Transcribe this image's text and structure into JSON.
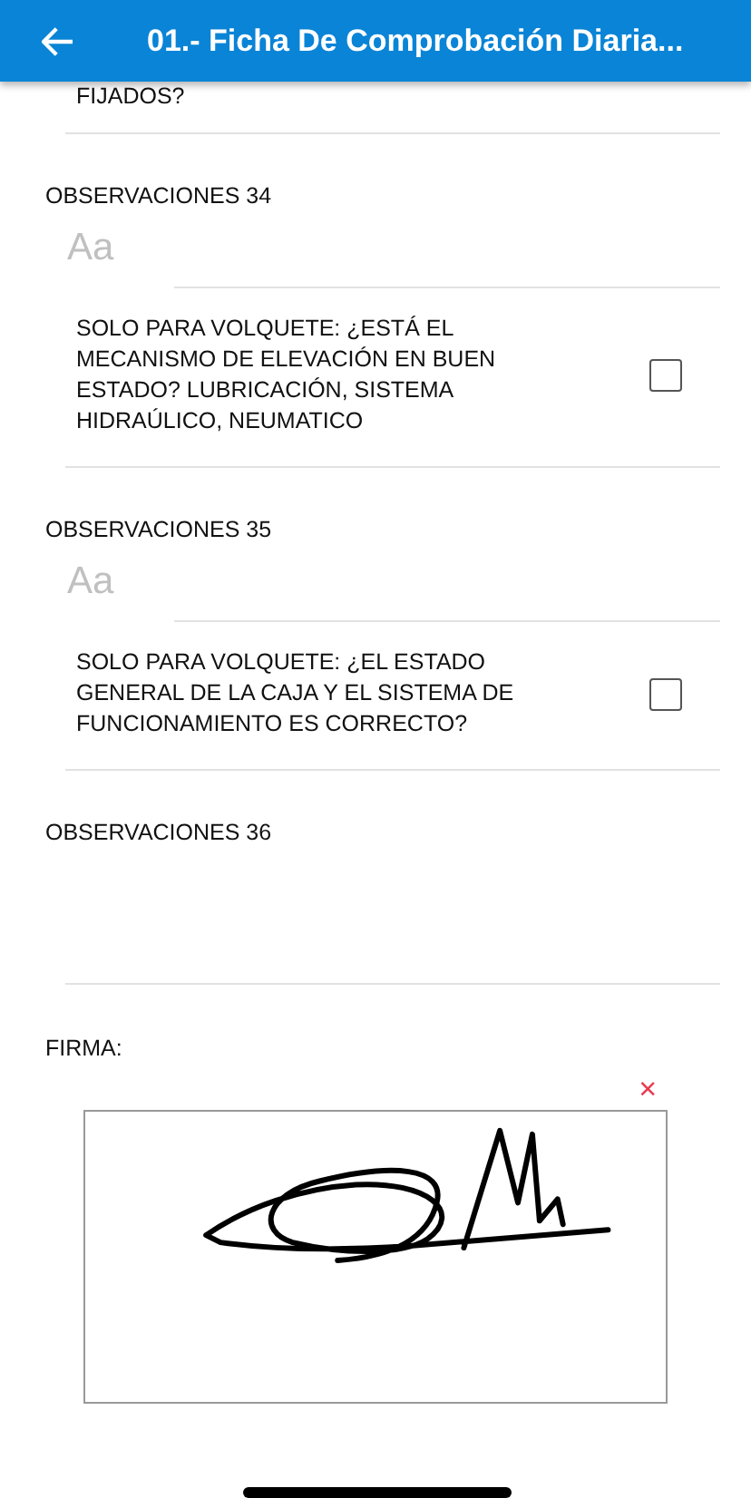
{
  "header": {
    "title": "01.- Ficha De Comprobación Diaria..."
  },
  "items": [
    {
      "kind": "question_tail",
      "text": "FIJADOS?"
    },
    {
      "kind": "observation",
      "label": "OBSERVACIONES 34",
      "placeholder": "Aa"
    },
    {
      "kind": "question",
      "text": "SOLO PARA VOLQUETE: ¿ESTÁ EL MECANISMO DE ELEVACIÓN EN BUEN ESTADO? LUBRICACIÓN, SISTEMA HIDRAÚLICO, NEUMATICO",
      "checked": false
    },
    {
      "kind": "observation",
      "label": "OBSERVACIONES 35",
      "placeholder": "Aa"
    },
    {
      "kind": "question",
      "text": "SOLO PARA VOLQUETE: ¿EL ESTADO GENERAL DE LA CAJA Y EL SISTEMA DE FUNCIONAMIENTO ES CORRECTO?",
      "checked": false
    },
    {
      "kind": "observation",
      "label": "OBSERVACIONES 36"
    },
    {
      "kind": "signature",
      "label": "FIRMA:",
      "clear": "×"
    }
  ]
}
